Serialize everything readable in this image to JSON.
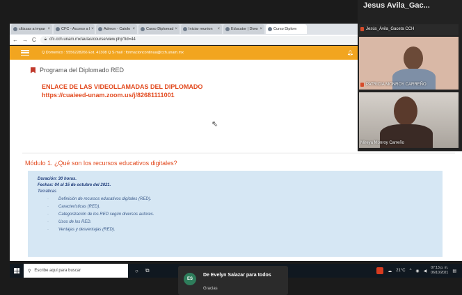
{
  "browser": {
    "tabs": [
      {
        "label": "cltizzas a impar"
      },
      {
        "label": "CFC - Acceso a l"
      },
      {
        "label": "Admon - Catolo"
      },
      {
        "label": "Curso Diplomad"
      },
      {
        "label": "Iniciar reunion"
      },
      {
        "label": "Educator | Diwo"
      },
      {
        "label": "Curso Diplom"
      }
    ],
    "url": "cfc.cch.unam.mx/aulas/course/view.php?id=44"
  },
  "site_header": {
    "contact": "Q Domenico : 5556228266 Ext. 41308 Q S mail : formacioncontinua@cch.unam.mx"
  },
  "content": {
    "program": "Programa del Diplomado RED",
    "enlace_title": "ENLACE DE LAS VIDEOLLAMADAS DEL DIPLOMADO",
    "enlace_url": "https://cuaieed-unam.zoom.us/j/82681111001",
    "module_title": "Módulo 1. ¿Qué son los recursos educativos digitales?",
    "duracion": "Duración: 30 horas.",
    "fechas": "Fechas: 04 al 15 de octubre del 2021.",
    "tematicas_label": "Temáticas",
    "topics": [
      "Definición de recursos educativos digitales (RED).",
      "Características (RED).",
      "Categorización de los RED según diversos autores.",
      "Usos de los RED.",
      "Ventajas y desventajas (RED)."
    ]
  },
  "taskbar": {
    "search_placeholder": "Escribe aquí para buscar",
    "temperature": "21°C",
    "time": "07:13 p. m.",
    "date": "06/10/2021"
  },
  "notification": {
    "avatar_initials": "ES",
    "sender": "De Evelyn Salazar para todos",
    "message": "Gracias"
  },
  "video_panel": {
    "host_name": "Jesus  Avila_Gac...",
    "tiles": [
      {
        "label": "Jesús_Ávila_Gaceta CCH"
      },
      {
        "label": "PATRICIA MONROY CARREÑO"
      },
      {
        "label": "Mireya Monroy Carreño"
      }
    ]
  },
  "colors": {
    "header_orange": "#f2a51f",
    "accent_red": "#e24a1f",
    "info_box": "#d6e7f4"
  }
}
